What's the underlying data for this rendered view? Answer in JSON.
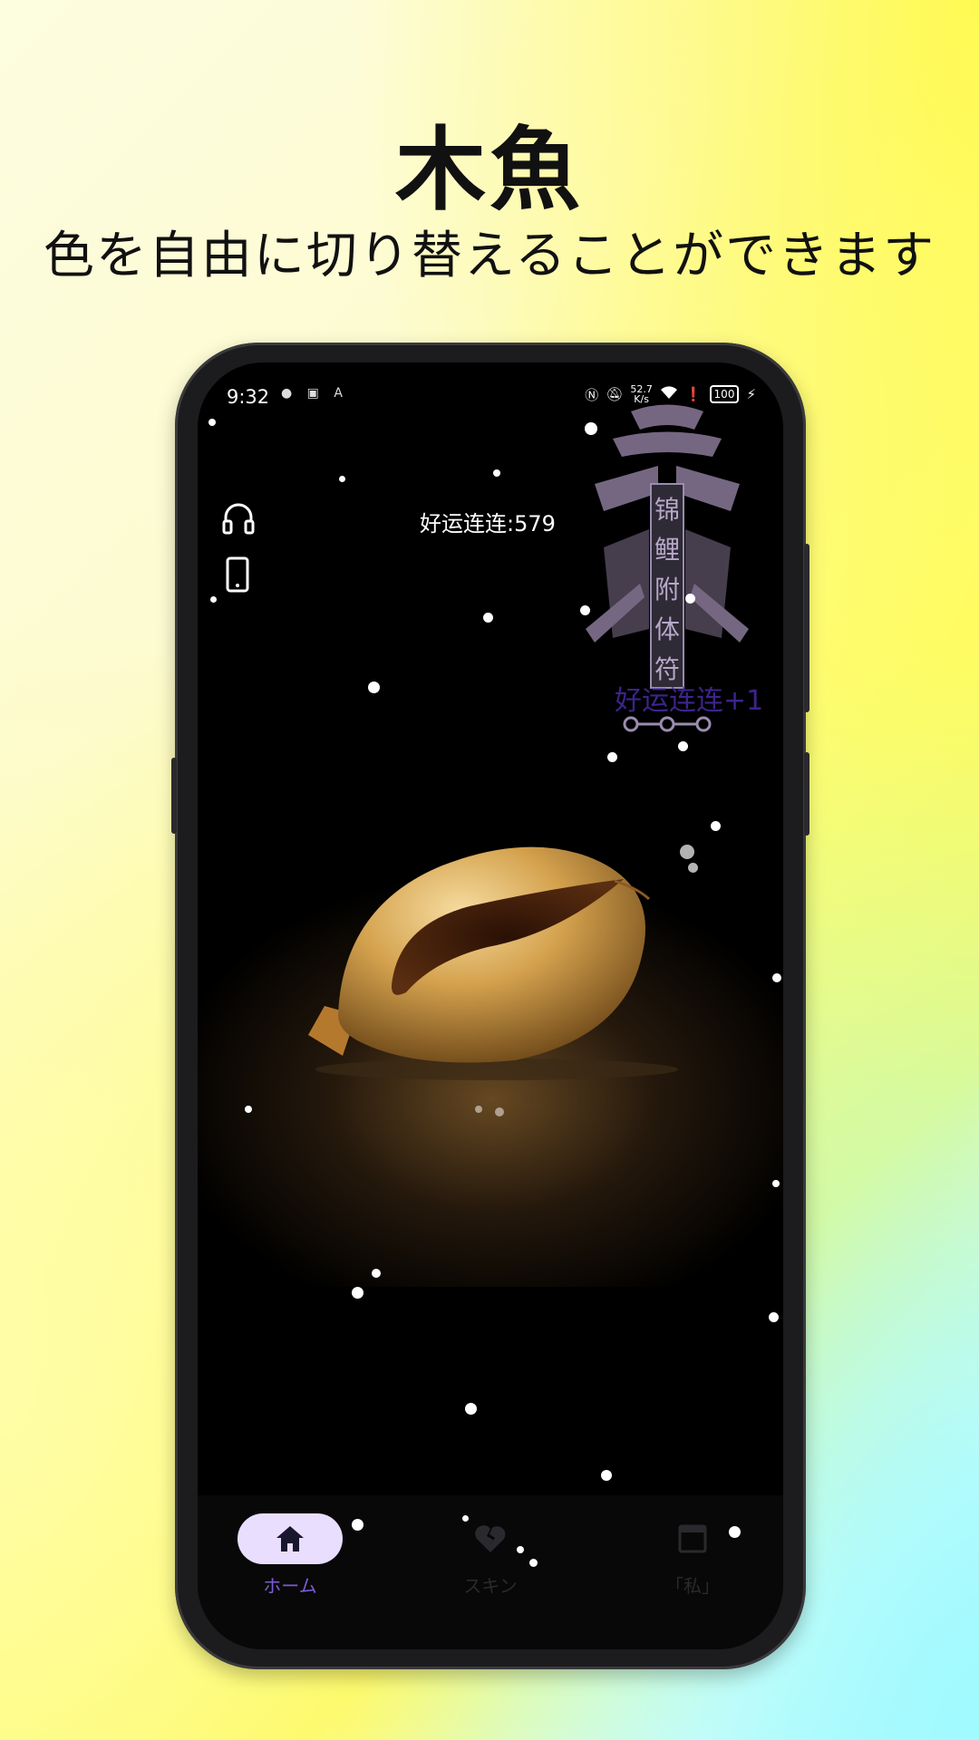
{
  "promo": {
    "title": "木魚",
    "subtitle": "色を自由に切り替えることができます"
  },
  "status_bar": {
    "time": "9:32",
    "net_speed_value": "52.7",
    "net_speed_unit": "K/s",
    "battery": "100"
  },
  "counter": {
    "text": "好运连连:579"
  },
  "charm": {
    "text": "锦鲤附体符"
  },
  "floating_text": "好运连连+1",
  "side_controls": [
    "headphones-icon",
    "phone-icon"
  ],
  "nav": {
    "items": [
      {
        "label": "ホーム",
        "icon": "home-icon",
        "active": true
      },
      {
        "label": "スキン",
        "icon": "broken-heart-icon",
        "active": false
      },
      {
        "label": "「私」",
        "icon": "window-icon",
        "active": false
      }
    ]
  },
  "colors": {
    "accent": "#e9defd",
    "active_label": "#7c5cd6",
    "inactive": "#2a2a2e",
    "plus_one": "#4b2db0"
  }
}
